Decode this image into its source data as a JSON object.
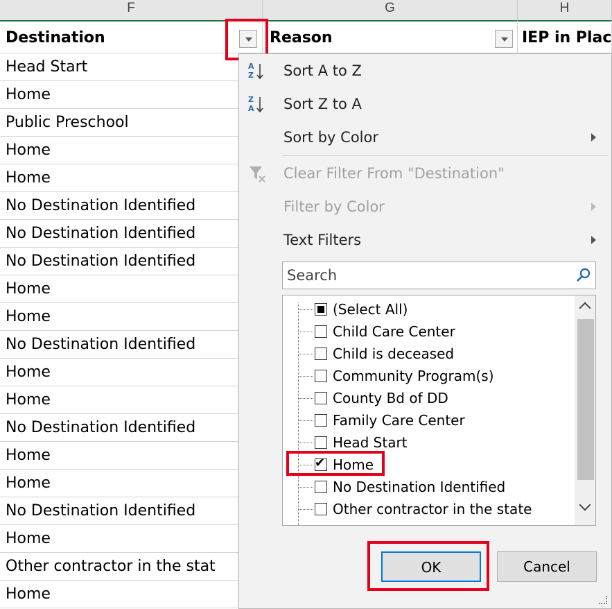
{
  "columns": {
    "f": "F",
    "g": "G",
    "h": "H"
  },
  "headers": {
    "destination": "Destination",
    "reason": "Reason",
    "iep": "IEP in Place"
  },
  "rows": [
    "Head Start",
    "Home",
    "Public Preschool",
    "Home",
    "Home",
    "No Destination Identified",
    "No Destination Identified",
    "No Destination Identified",
    "Home",
    "Home",
    "No Destination Identified",
    "Home",
    "Home",
    "No Destination Identified",
    "Home",
    "Home",
    "No Destination Identified",
    "Home",
    "Other contractor in the stat",
    "Home"
  ],
  "menu": {
    "sort_az": "Sort A to Z",
    "sort_za": "Sort Z to A",
    "sort_color": "Sort by Color",
    "clear_filter": "Clear Filter From \"Destination\"",
    "filter_color": "Filter by Color",
    "text_filters": "Text Filters",
    "search_placeholder": "Search"
  },
  "filter_items": [
    {
      "label": "(Select All)",
      "state": "partial"
    },
    {
      "label": "Child Care Center",
      "state": "unchecked"
    },
    {
      "label": "Child is deceased",
      "state": "unchecked"
    },
    {
      "label": "Community Program(s)",
      "state": "unchecked"
    },
    {
      "label": "County Bd of DD",
      "state": "unchecked"
    },
    {
      "label": "Family Care Center",
      "state": "unchecked"
    },
    {
      "label": "Head Start",
      "state": "unchecked"
    },
    {
      "label": "Home",
      "state": "checked"
    },
    {
      "label": "No Destination Identified",
      "state": "unchecked"
    },
    {
      "label": "Other contractor in the state",
      "state": "unchecked"
    }
  ],
  "buttons": {
    "ok": "OK",
    "cancel": "Cancel"
  },
  "colors": {
    "highlight": "#e3001b",
    "excel_green": "#217346",
    "ok_border": "#0078d7"
  }
}
